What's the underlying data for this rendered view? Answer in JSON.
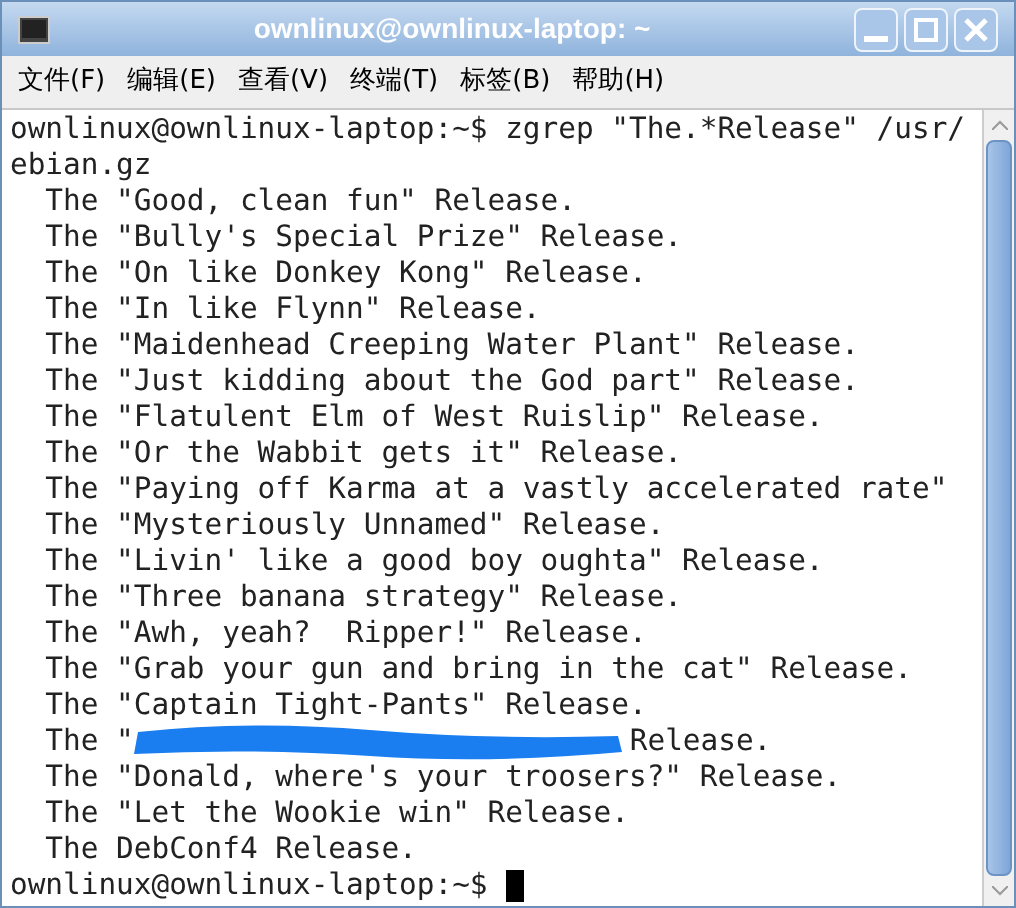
{
  "window": {
    "title": "ownlinux@ownlinux-laptop: ~"
  },
  "menu": [
    "文件(F)",
    "编辑(E)",
    "查看(V)",
    "终端(T)",
    "标签(B)",
    "帮助(H)"
  ],
  "terminal": {
    "lines": [
      {
        "kind": "text",
        "text": "ownlinux@ownlinux-laptop:~$ zgrep \"The.*Release\" /usr/"
      },
      {
        "kind": "text",
        "text": "ebian.gz"
      },
      {
        "kind": "text",
        "text": "  The \"Good, clean fun\" Release."
      },
      {
        "kind": "text",
        "text": "  The \"Bully's Special Prize\" Release."
      },
      {
        "kind": "text",
        "text": "  The \"On like Donkey Kong\" Release."
      },
      {
        "kind": "text",
        "text": "  The \"In like Flynn\" Release."
      },
      {
        "kind": "text",
        "text": "  The \"Maidenhead Creeping Water Plant\" Release."
      },
      {
        "kind": "text",
        "text": "  The \"Just kidding about the God part\" Release."
      },
      {
        "kind": "text",
        "text": "  The \"Flatulent Elm of West Ruislip\" Release."
      },
      {
        "kind": "text",
        "text": "  The \"Or the Wabbit gets it\" Release."
      },
      {
        "kind": "text",
        "text": "  The \"Paying off Karma at a vastly accelerated rate\""
      },
      {
        "kind": "text",
        "text": "  The \"Mysteriously Unnamed\" Release."
      },
      {
        "kind": "text",
        "text": "  The \"Livin' like a good boy oughta\" Release."
      },
      {
        "kind": "text",
        "text": "  The \"Three banana strategy\" Release."
      },
      {
        "kind": "text",
        "text": "  The \"Awh, yeah?  Ripper!\" Release."
      },
      {
        "kind": "text",
        "text": "  The \"Grab your gun and bring in the cat\" Release."
      },
      {
        "kind": "text",
        "text": "  The \"Captain Tight-Pants\" Release."
      },
      {
        "kind": "redacted",
        "before": "  The \"",
        "after": "Release."
      },
      {
        "kind": "text",
        "text": "  The \"Donald, where's your troosers?\" Release."
      },
      {
        "kind": "text",
        "text": "  The \"Let the Wookie win\" Release."
      },
      {
        "kind": "text",
        "text": "  The DebConf4 Release."
      },
      {
        "kind": "prompt",
        "text": "ownlinux@ownlinux-laptop:~$ "
      }
    ]
  }
}
